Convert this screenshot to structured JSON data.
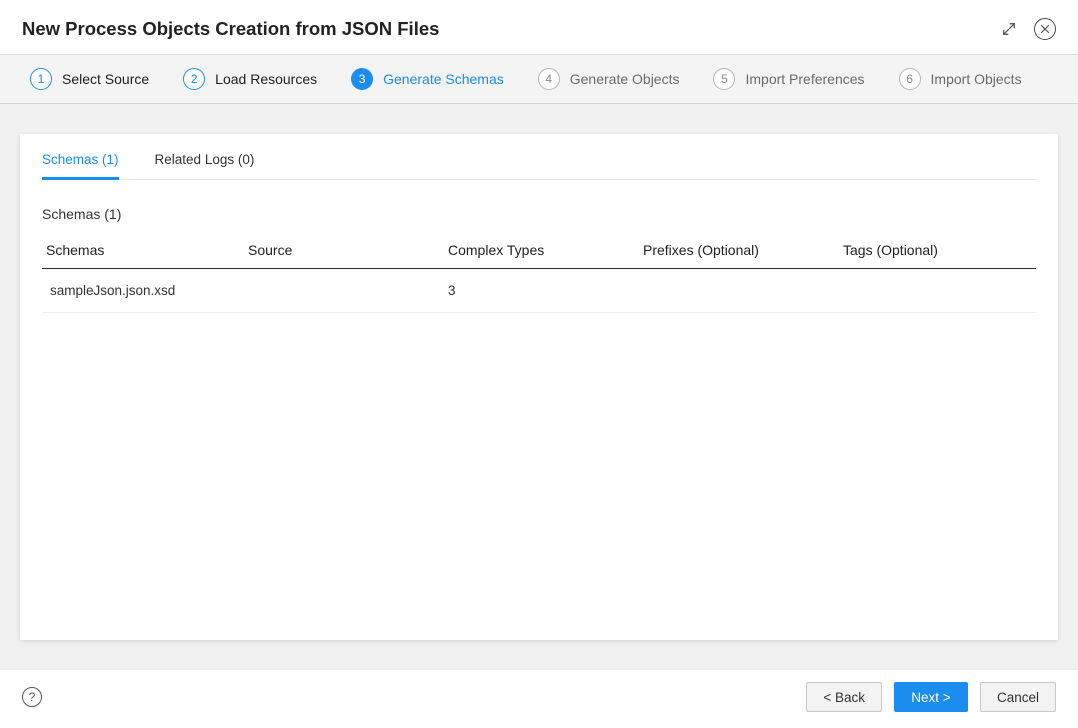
{
  "header": {
    "title": "New Process Objects Creation from JSON Files"
  },
  "stepper": {
    "steps": [
      {
        "num": "1",
        "label": "Select Source",
        "state": "done"
      },
      {
        "num": "2",
        "label": "Load Resources",
        "state": "done"
      },
      {
        "num": "3",
        "label": "Generate Schemas",
        "state": "current"
      },
      {
        "num": "4",
        "label": "Generate Objects",
        "state": "pending"
      },
      {
        "num": "5",
        "label": "Import Preferences",
        "state": "pending"
      },
      {
        "num": "6",
        "label": "Import Objects",
        "state": "pending"
      }
    ]
  },
  "tabs": {
    "items": [
      {
        "label": "Schemas (1)",
        "active": true
      },
      {
        "label": "Related Logs (0)",
        "active": false
      }
    ]
  },
  "section": {
    "heading": "Schemas (1)"
  },
  "table": {
    "columns": [
      "Schemas",
      "Source",
      "Complex Types",
      "Prefixes (Optional)",
      "Tags (Optional)"
    ],
    "rows": [
      {
        "cells": [
          "sampleJson.json.xsd",
          "",
          "3",
          "",
          ""
        ]
      }
    ]
  },
  "footer": {
    "help": "?",
    "back": "< Back",
    "next": "Next >",
    "cancel": "Cancel"
  }
}
